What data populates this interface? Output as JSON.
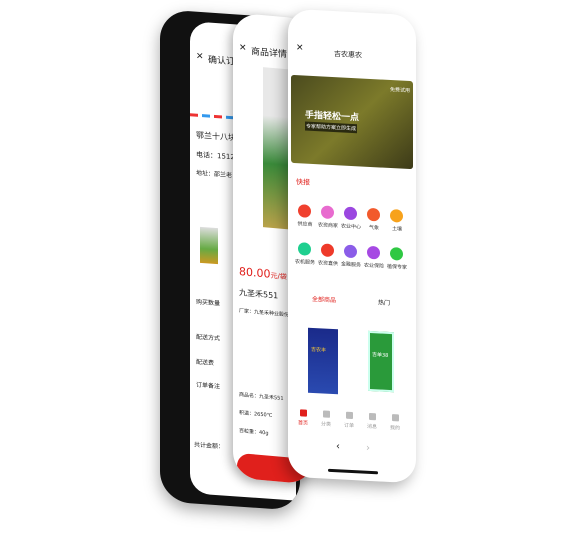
{
  "order": {
    "close": "✕",
    "title": "确认订单",
    "name": "鄂兰十八块农",
    "phone": "电话：15124",
    "address": "地址：邵兰老",
    "rows": [
      "购买数量",
      "配送方式",
      "配送费",
      "订单备注"
    ],
    "total": "共计金额："
  },
  "detail": {
    "close": "✕",
    "title": "商品详情",
    "price": "80.00",
    "unit": "元/袋",
    "product": "九圣禾551",
    "maker": "厂家：九圣禾种业股份",
    "specs": [
      "商品名：九圣禾551",
      "积温：2650℃",
      "百粒重：40g"
    ]
  },
  "home": {
    "close": "✕",
    "title": "吉农惠农",
    "banner_action": "免费试用",
    "banner_title": "手指轻松一点",
    "banner_sub": "专家帮助方案立即生成",
    "news_label": "快报",
    "icons": [
      {
        "label": "供应商",
        "color": "#f0402e"
      },
      {
        "label": "农资商家",
        "color": "#e86bcf"
      },
      {
        "label": "农业中心",
        "color": "#9b47e0"
      },
      {
        "label": "气象",
        "color": "#f25a2c"
      },
      {
        "label": "土壤",
        "color": "#f7a21c"
      },
      {
        "label": "农机服务",
        "color": "#1fcf8f"
      },
      {
        "label": "农资直供",
        "color": "#ee3a2a"
      },
      {
        "label": "金融服务",
        "color": "#8b5de8"
      },
      {
        "label": "农业保险",
        "color": "#a649e3"
      },
      {
        "label": "植保专家",
        "color": "#2fc843"
      }
    ],
    "tabs": [
      "全部商品",
      "热门"
    ],
    "products": [
      "吉农丰",
      "吉单38"
    ],
    "nav": [
      "首页",
      "分类",
      "订单",
      "消息",
      "我的"
    ],
    "back": "‹",
    "forward": "›"
  },
  "colors": {
    "accent": "#e0201c"
  }
}
